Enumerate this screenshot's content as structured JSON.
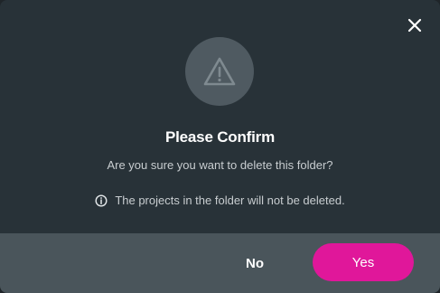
{
  "dialog": {
    "title": "Please Confirm",
    "message": "Are you sure you want to delete this folder?",
    "note": "The projects in the folder will not be deleted.",
    "icons": {
      "close": "close-icon",
      "warning": "warning-triangle-icon",
      "info": "info-icon"
    }
  },
  "footer": {
    "no_label": "No",
    "yes_label": "Yes"
  },
  "colors": {
    "dialog_bg": "#283238",
    "footer_bg": "#4a555b",
    "accent": "#e0179a",
    "icon_circle": "#4f5a61"
  }
}
